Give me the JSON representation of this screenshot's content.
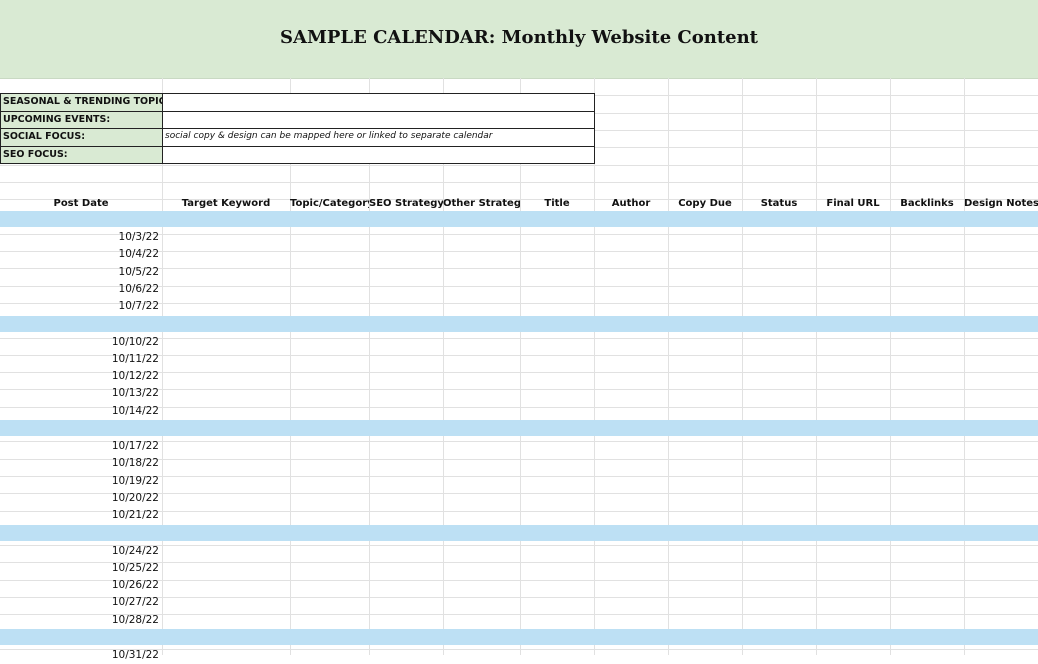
{
  "title": "SAMPLE CALENDAR: Monthly Website Content",
  "info_rows": [
    {
      "label": "SEASONAL & TRENDING TOPICS:",
      "value": ""
    },
    {
      "label": "UPCOMING EVENTS:",
      "value": ""
    },
    {
      "label": "SOCIAL FOCUS:",
      "value": "social copy & design can be mapped here or linked to separate calendar"
    },
    {
      "label": "SEO FOCUS:",
      "value": ""
    }
  ],
  "columns": [
    "Post Date",
    "Target Keyword",
    "Topic/Category",
    "SEO Strategy",
    "Other Strategy",
    "Title",
    "Author",
    "Copy Due",
    "Status",
    "Final URL",
    "Backlinks",
    "Design Notes"
  ],
  "weeks": [
    [
      "10/3/22",
      "10/4/22",
      "10/5/22",
      "10/6/22",
      "10/7/22"
    ],
    [
      "10/10/22",
      "10/11/22",
      "10/12/22",
      "10/13/22",
      "10/14/22"
    ],
    [
      "10/17/22",
      "10/18/22",
      "10/19/22",
      "10/20/22",
      "10/21/22"
    ],
    [
      "10/24/22",
      "10/25/22",
      "10/26/22",
      "10/27/22",
      "10/28/22"
    ],
    [
      "10/31/22"
    ]
  ],
  "colors": {
    "title_band": "#d9ead3",
    "week_separator": "#bde0f4",
    "gridline": "#e1e1e1"
  }
}
